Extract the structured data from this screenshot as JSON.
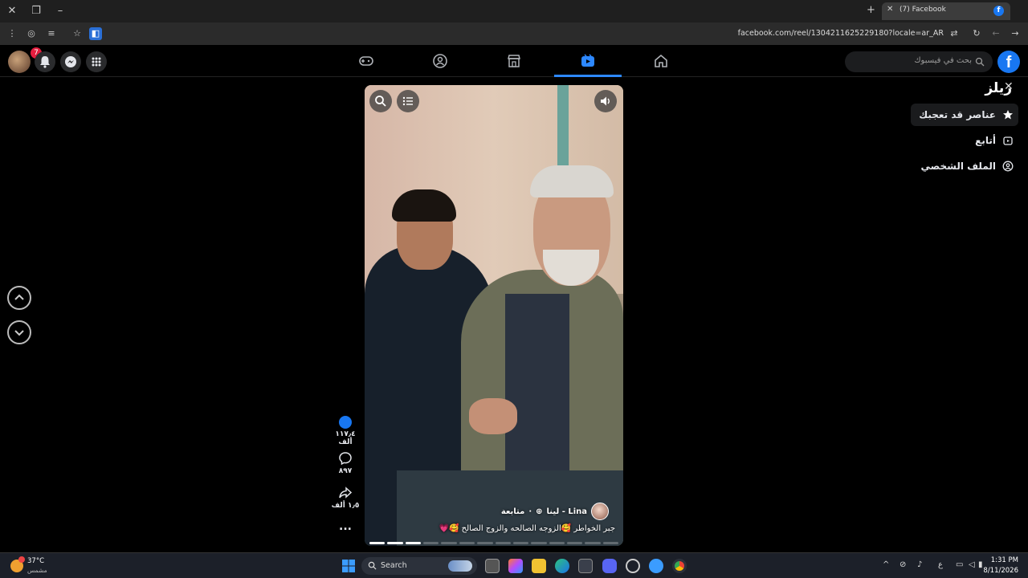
{
  "browser": {
    "tab_title": "(7) Facebook",
    "url": "facebook.com/reel/1304211625229180?locale=ar_AR"
  },
  "topnav": {
    "search_placeholder": "بحث في فيسبوك",
    "notifications_count": "7",
    "logo_letter": "f"
  },
  "sidebar": {
    "title": "ريلز",
    "items": [
      {
        "label": "عناصر قد تعجبك",
        "icon": "star-icon",
        "active": true
      },
      {
        "label": "أتابع",
        "icon": "following-icon",
        "active": false
      },
      {
        "label": "الملف الشخصي",
        "icon": "profile-icon",
        "active": false
      }
    ]
  },
  "reel": {
    "author": "لينا - Lina",
    "follow_label": "متابعة",
    "separator": "·",
    "caption": "جبر الخواطر 🥰الزوجه الصالحه والزوج الصالح 🥰💗"
  },
  "actions": {
    "likes": "١١٧٫٤ ألف",
    "comments": "٨٩٧",
    "shares": "١٫٥ ألف",
    "more": "..."
  },
  "taskbar": {
    "weather_temp": "37°C",
    "weather_desc": "مشمس",
    "search_label": "Search",
    "lang": "ع",
    "time": "1:31 PM",
    "date": "8/11/2026"
  },
  "colors": {
    "fb_blue": "#1877f2",
    "active_nav": "#2d88ff",
    "badge_red": "#e41e3f"
  }
}
